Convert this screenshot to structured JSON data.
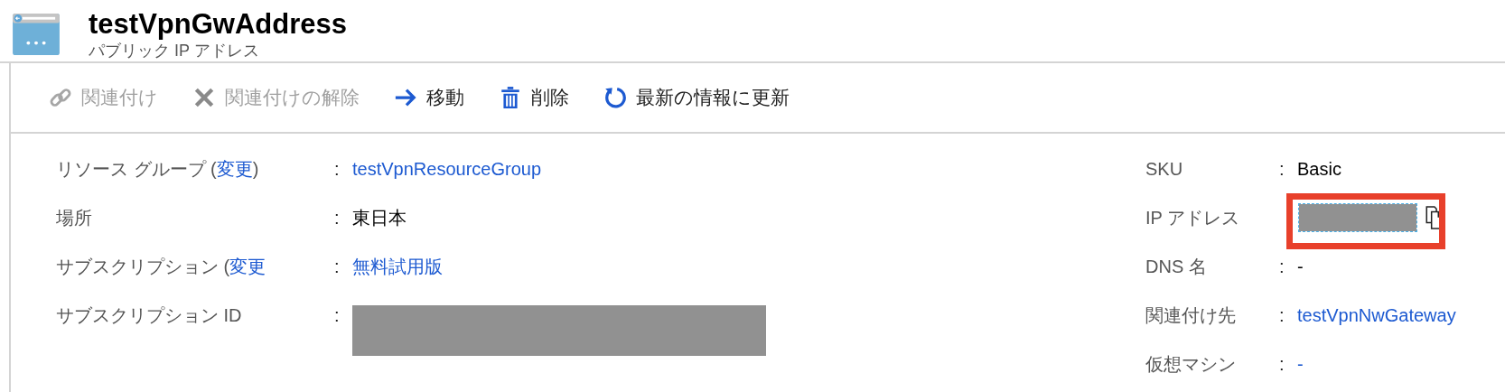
{
  "header": {
    "title": "testVpnGwAddress",
    "subtitle": "パブリック IP アドレス"
  },
  "toolbar": [
    {
      "kind": "link",
      "label": "関連付け",
      "disabled": true
    },
    {
      "kind": "close",
      "label": "関連付けの解除",
      "disabled": true
    },
    {
      "kind": "arrow",
      "label": "移動",
      "disabled": false
    },
    {
      "kind": "trash",
      "label": "削除",
      "disabled": false
    },
    {
      "kind": "refresh",
      "label": "最新の情報に更新",
      "disabled": false
    }
  ],
  "essentials_left": [
    {
      "label": {
        "before": "リソース グループ (",
        "link": "変更",
        "after": ")"
      },
      "separator": ":",
      "kind": "link",
      "value": "testVpnResourceGroup"
    },
    {
      "label": {
        "before": "場所"
      },
      "separator": ":",
      "kind": "text",
      "value": "東日本"
    },
    {
      "label": {
        "before": "サブスクリプション (",
        "link": "変更"
      },
      "separator": ":",
      "kind": "link",
      "value": "無料試用版"
    },
    {
      "label": {
        "before": "サブスクリプション ID"
      },
      "separator": ":",
      "kind": "redacted"
    }
  ],
  "essentials_right": [
    {
      "label": {
        "before": "SKU"
      },
      "separator": ":",
      "kind": "text",
      "value": "Basic"
    },
    {
      "label": {
        "before": "IP アドレス"
      },
      "kind": "redacted_copy",
      "highlighted": true
    },
    {
      "label": {
        "before": "DNS 名"
      },
      "separator": ":",
      "kind": "text",
      "value": "-"
    },
    {
      "label": {
        "before": "関連付け先"
      },
      "separator": ":",
      "kind": "link",
      "value": "testVpnNwGateway"
    },
    {
      "label": {
        "before": "仮想マシン"
      },
      "separator": ":",
      "kind": "link",
      "value": "-"
    }
  ]
}
